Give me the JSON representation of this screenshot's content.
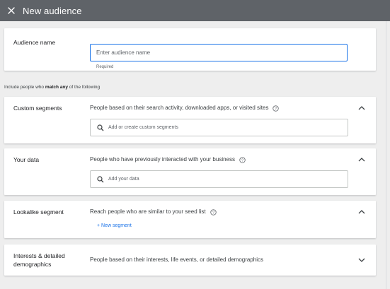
{
  "header": {
    "title": "New audience",
    "close_icon": "close-icon"
  },
  "audience_name": {
    "label": "Audience name",
    "placeholder": "Enter audience name",
    "value": "",
    "hint": "Required"
  },
  "include": {
    "prefix": "Include people who ",
    "bold1": "match any",
    "suffix": " of the following"
  },
  "sections": {
    "custom": {
      "label": "Custom segments",
      "description": "People based on their search activity, downloaded apps, or visited sites",
      "search_placeholder": "Add or create custom segments",
      "expanded": true
    },
    "your_data": {
      "label": "Your data",
      "description": "People who have previously interacted with your business",
      "search_placeholder": "Add your data",
      "expanded": true
    },
    "lookalike": {
      "label": "Lookalike segment",
      "description": "Reach people who are similar to your seed list",
      "action": "+ New segment",
      "expanded": true
    },
    "interests": {
      "label_line1": "Interests & detailed",
      "label_line2": "demographics",
      "description": "People based on their interests, life events, or detailed demographics",
      "expanded": false
    }
  },
  "colors": {
    "header_bg": "#5f6368",
    "accent": "#1a73e8",
    "page_bg": "#eeeeee"
  }
}
